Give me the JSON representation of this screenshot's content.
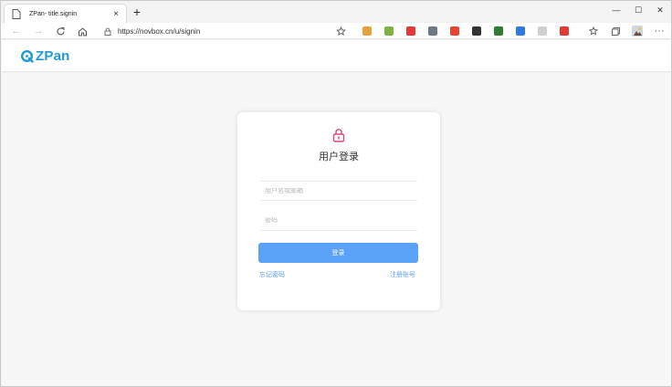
{
  "browser": {
    "tab_title": "ZPan- title.signin",
    "close_tab": "×",
    "new_tab": "+",
    "window_controls": {
      "minimize": "—",
      "maximize": "☐",
      "close": "✕"
    },
    "url": "https://novbox.cn/u/signin",
    "more_menu": "···",
    "extension_colors": [
      "#e9a23b",
      "#7cb342",
      "#e53935",
      "#6d7a86",
      "#e8442f",
      "#333333",
      "#2e7d32",
      "#2f7be0",
      "#cfcfcf",
      "#e53935"
    ]
  },
  "site": {
    "logo_text": "ZPan",
    "brand_color": "#1e9bd7"
  },
  "login": {
    "heading": "用户登录",
    "username_placeholder": "用户名或邮箱",
    "password_placeholder": "密码",
    "submit_label": "登录",
    "forgot_password": "忘记密码",
    "register": "注册账号",
    "accent_color": "#5aa2f7",
    "lock_color": "#e0437b"
  }
}
